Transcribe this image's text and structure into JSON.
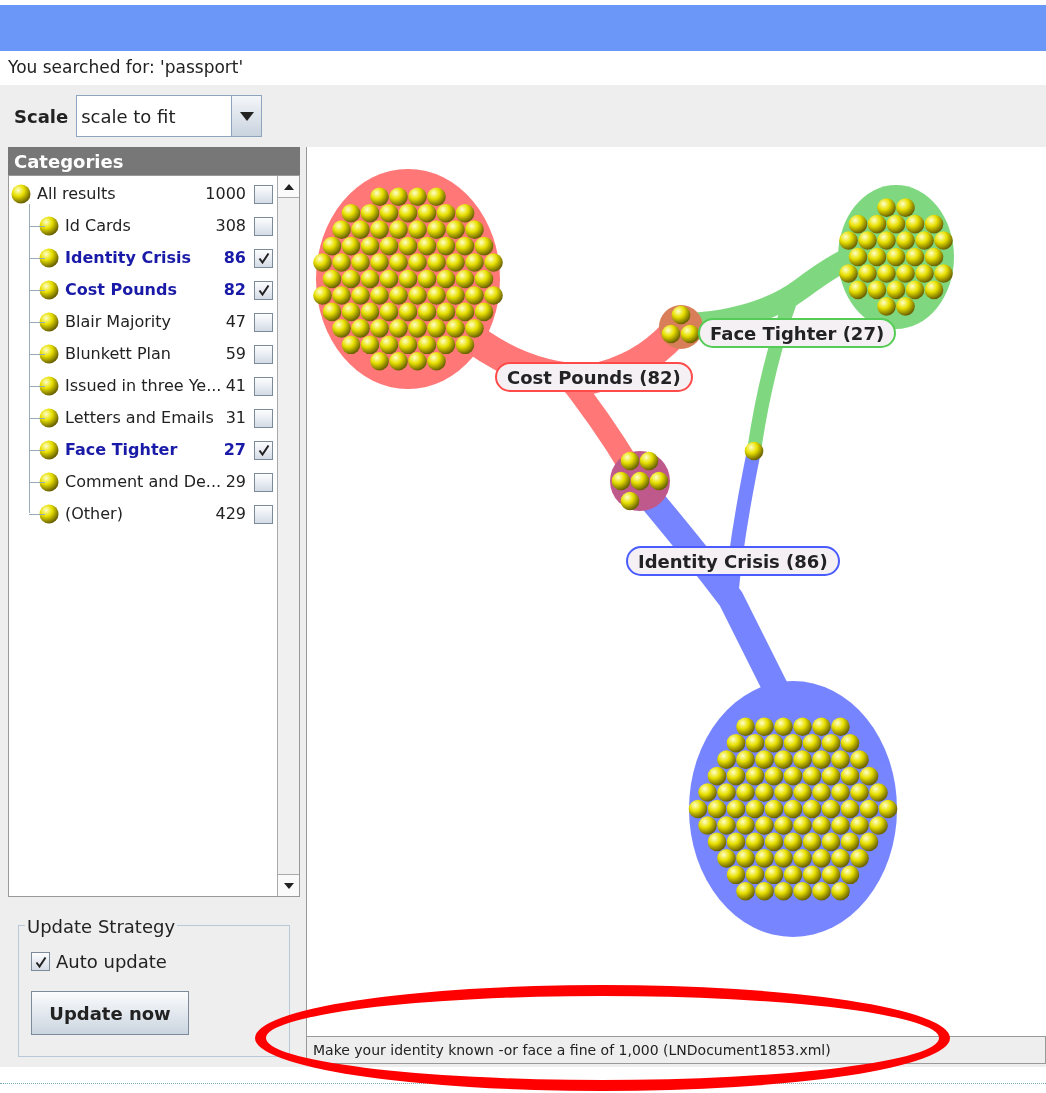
{
  "search_info": "You searched for: 'passport'",
  "scale": {
    "label": "Scale",
    "value": "scale to fit"
  },
  "categories": {
    "title": "Categories",
    "root": {
      "name": "All results",
      "count": "1000",
      "checked": false,
      "children": [
        {
          "name": "Id Cards",
          "count": "308",
          "checked": false
        },
        {
          "name": "Identity Crisis",
          "count": "86",
          "checked": true
        },
        {
          "name": "Cost Pounds",
          "count": "82",
          "checked": true
        },
        {
          "name": "Blair Majority",
          "count": "47",
          "checked": false
        },
        {
          "name": "Blunkett Plan",
          "count": "59",
          "checked": false
        },
        {
          "name": "Issued in three Ye...",
          "count": "41",
          "checked": false
        },
        {
          "name": "Letters and Emails",
          "count": "31",
          "checked": false
        },
        {
          "name": "Face Tighter",
          "count": "27",
          "checked": true
        },
        {
          "name": "Comment and De...",
          "count": "29",
          "checked": false
        },
        {
          "name": "(Other)",
          "count": "429",
          "checked": false
        }
      ]
    }
  },
  "update_strategy": {
    "title": "Update Strategy",
    "auto_update": {
      "label": "Auto update",
      "checked": true
    },
    "button": "Update now"
  },
  "clusters": [
    {
      "label": "Cost Pounds (82)",
      "color": "#ff4a4a"
    },
    {
      "label": "Face Tighter (27)",
      "color": "#55cc55"
    },
    {
      "label": "Identity Crisis (86)",
      "color": "#4a5cff"
    }
  ],
  "status_bar": "Make your identity known -or face a fine of 1,000 (LNDocument1853.xml)"
}
